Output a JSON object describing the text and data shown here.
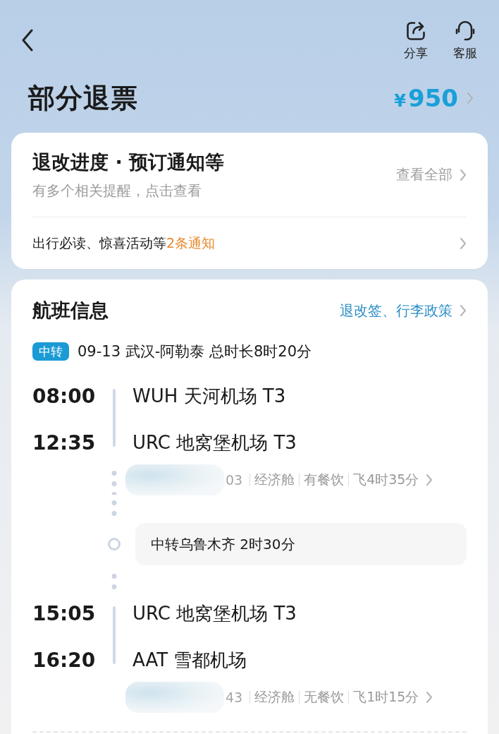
{
  "header": {
    "actions": [
      {
        "kind": "share",
        "label": "分享"
      },
      {
        "kind": "service",
        "label": "客服"
      }
    ]
  },
  "title": "部分退票",
  "price": {
    "currency": "¥",
    "amount": "950"
  },
  "notice_card": {
    "title": "退改进度 · 预订通知等",
    "subtitle": "有多个相关提醒，点击查看",
    "view_all": "查看全部",
    "row_text": "出行必读、惊喜活动等",
    "row_highlight": "2条通知"
  },
  "flight_info": {
    "title": "航班信息",
    "policy_link": "退改签、行李政策",
    "tag": "中转",
    "summary": "09-13 武汉-阿勒泰 总时长8时20分",
    "legs": [
      {
        "kind": "segment",
        "depart_time": "08:00",
        "depart_airport": "WUH 天河机场 T3",
        "arrive_time": "12:35",
        "arrive_airport": "URC 地窝堡机场 T3",
        "redacted": true,
        "flight_no_tail": "03",
        "details": [
          "经济舱",
          "有餐饮",
          "飞4时35分"
        ]
      },
      {
        "kind": "transfer",
        "text": "中转乌鲁木齐 2时30分"
      },
      {
        "kind": "segment",
        "depart_time": "15:05",
        "depart_airport": "URC 地窝堡机场 T3",
        "arrive_time": "16:20",
        "arrive_airport": "AAT 雪都机场",
        "redacted": true,
        "flight_no_tail": "43",
        "details": [
          "经济舱",
          "无餐饮",
          "飞1时15分"
        ]
      }
    ]
  }
}
